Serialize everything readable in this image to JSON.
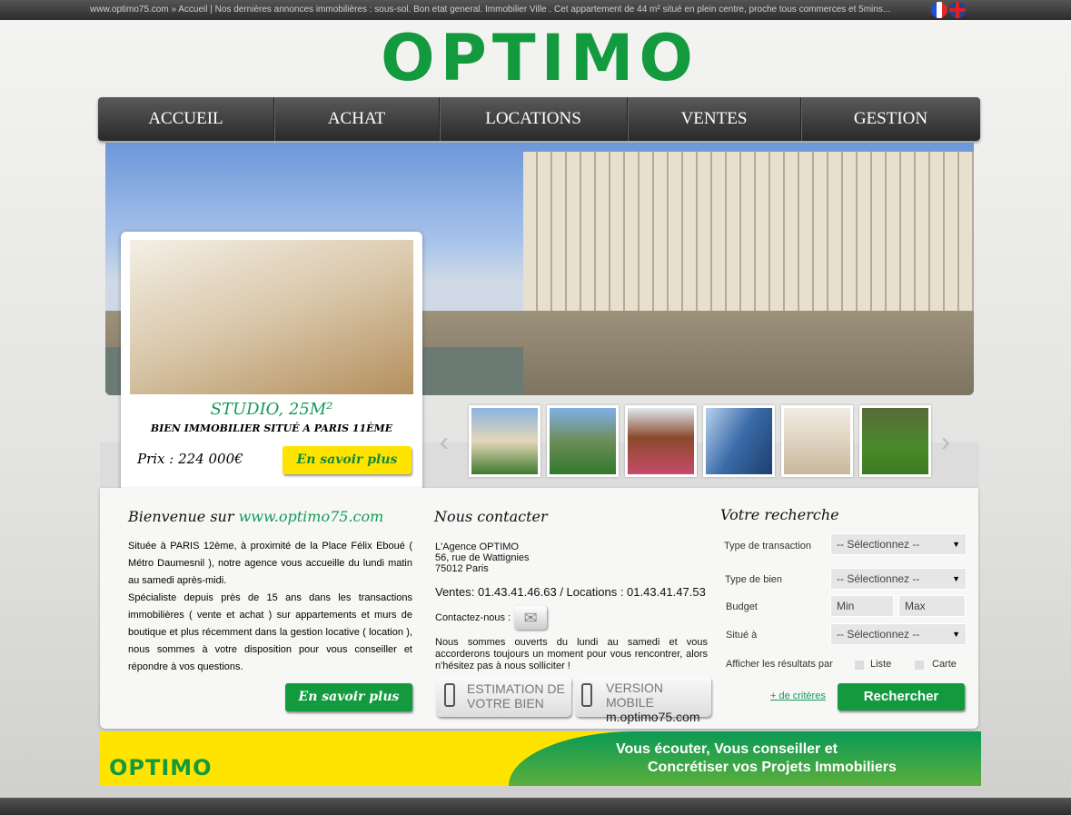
{
  "topbar": {
    "breadcrumb": "www.optimo75.com » Accueil  |  Nos dernières annonces immobilières : sous-sol. Bon etat general. Immobilier Ville . Cet appartement de 44 m² situé en plein centre, proche tous commerces et 5mins..."
  },
  "logo": "OPTIMO",
  "nav": [
    "ACCUEIL",
    "ACHAT",
    "LOCATIONS",
    "VENTES",
    "GESTION"
  ],
  "featured": {
    "title": "STUDIO, 25M²",
    "subtitle": "BIEN IMMOBILIER SITUÉ A PARIS 11ÈME",
    "price": "Prix : 224 000€",
    "button": "En savoir plus"
  },
  "welcome": {
    "title": "Bienvenue sur ",
    "site": "www.optimo75.com",
    "p1": "Située à PARIS 12ème, à proximité de la Place Félix Eboué ( Métro Daumesnil ), notre agence vous accueille du lundi matin au samedi après-midi.",
    "p2": "Spécialiste depuis près de 15 ans dans les transactions immobilières ( vente et achat ) sur appartements et murs de boutique et plus récemment dans la gestion locative ( location ), nous sommes à votre disposition pour vous conseiller et répondre à vos questions.",
    "button": "En savoir plus"
  },
  "contact": {
    "title": "Nous contacter",
    "name": "L'Agence OPTIMO",
    "street": "56, rue de Wattignies",
    "city": "75012 Paris",
    "phones": "Ventes: 01.43.41.46.63 / Locations : 01.43.41.47.53",
    "contact_label": "Contactez-nous :",
    "hours": "Nous sommes ouverts du lundi au samedi et vous accorderons toujours un moment pour vous rencontrer, alors n'hésitez pas à nous solliciter !",
    "estimation": [
      "ESTIMATION DE",
      "VOTRE BIEN"
    ],
    "mobile": [
      "VERSION MOBILE",
      "m.optimo75.com"
    ]
  },
  "search": {
    "title": "Votre recherche",
    "transaction_label": "Type de transaction",
    "bien_label": "Type de bien",
    "budget_label": "Budget",
    "situe_label": "Situé à",
    "select_placeholder": "-- Sélectionnez --",
    "min": "Min",
    "max": "Max",
    "afficher_label": "Afficher les résultats par",
    "liste": "Liste",
    "carte": "Carte",
    "more": "+ de critères",
    "button": "Rechercher"
  },
  "banner": {
    "logo": "OPTIMO",
    "line1": "Vous écouter, Vous conseiller et",
    "line2": "Concrétiser vos Projets Immobiliers"
  },
  "colors": {
    "green": "#139a3e",
    "yellow": "#ffe400"
  }
}
